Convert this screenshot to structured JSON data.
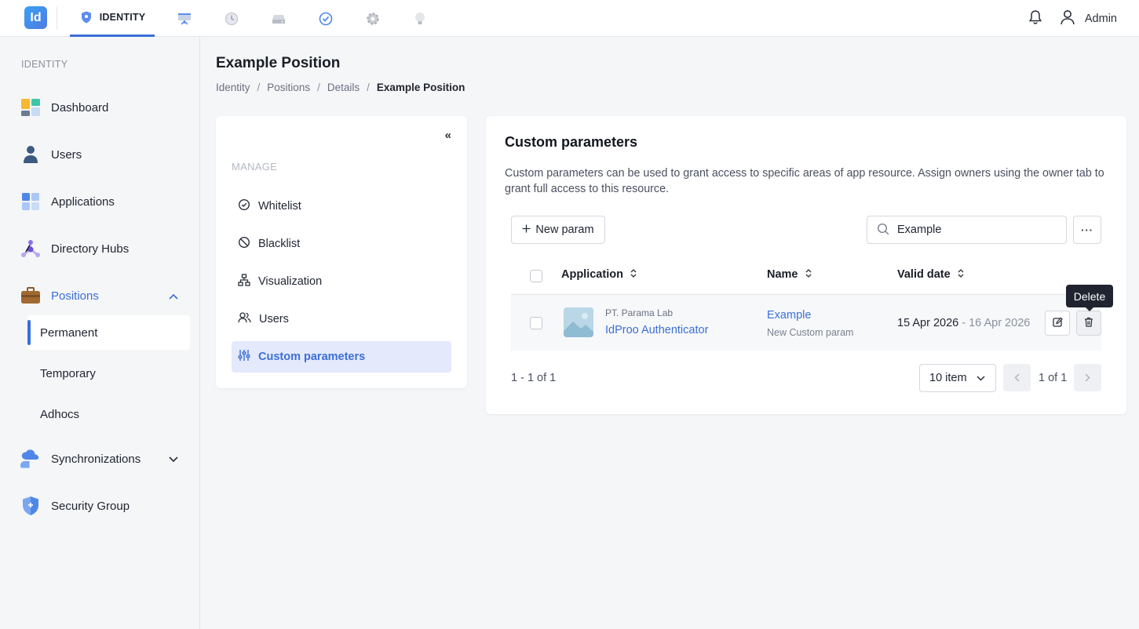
{
  "topbar": {
    "logo_text": "Id",
    "active_app": "IDENTITY",
    "user_name": "Admin",
    "app_icons": [
      "identity-shield-icon",
      "presentation-icon",
      "clock-icon",
      "drive-icon",
      "check-circle-icon",
      "gear-icon",
      "bulb-icon"
    ]
  },
  "sidebar": {
    "section": "IDENTITY",
    "items": [
      {
        "label": "Dashboard",
        "icon": "dashboard-icon"
      },
      {
        "label": "Users",
        "icon": "user-icon"
      },
      {
        "label": "Applications",
        "icon": "applications-icon"
      },
      {
        "label": "Directory Hubs",
        "icon": "hub-icon"
      },
      {
        "label": "Positions",
        "icon": "briefcase-icon"
      },
      {
        "label": "Synchronizations",
        "icon": "cloud-sync-icon"
      },
      {
        "label": "Security Group",
        "icon": "shield-icon"
      }
    ],
    "position_sub": [
      "Permanent",
      "Temporary",
      "Adhocs"
    ]
  },
  "page": {
    "title": "Example Position",
    "breadcrumb": [
      "Identity",
      "Positions",
      "Details",
      "Example Position"
    ]
  },
  "manage": {
    "collapse": "«",
    "section": "MANAGE",
    "items": [
      "Whitelist",
      "Blacklist",
      "Visualization",
      "Users",
      "Custom parameters"
    ]
  },
  "card": {
    "title": "Custom parameters",
    "description": "Custom parameters can be used to grant access to specific areas of app resource. Assign owners using the owner tab to grant full access to this resource.",
    "new_button": "New param",
    "search_value": "Example",
    "more": "···",
    "columns": [
      "Application",
      "Name",
      "Valid date"
    ],
    "rows": [
      {
        "org": "PT. Parama Lab",
        "app": "IdProo Authenticator",
        "name": "Example",
        "name_desc": "New Custom param",
        "date_from": "15 Apr 2026",
        "date_sep": " - ",
        "date_to": "16 Apr 2026"
      }
    ],
    "tooltip": "Delete",
    "range": "1 - 1 of 1",
    "per_page": "10 item",
    "pages": "1 of 1"
  },
  "colors": {
    "accent": "#3b6fd8",
    "active_bg": "#e4e9fb"
  }
}
